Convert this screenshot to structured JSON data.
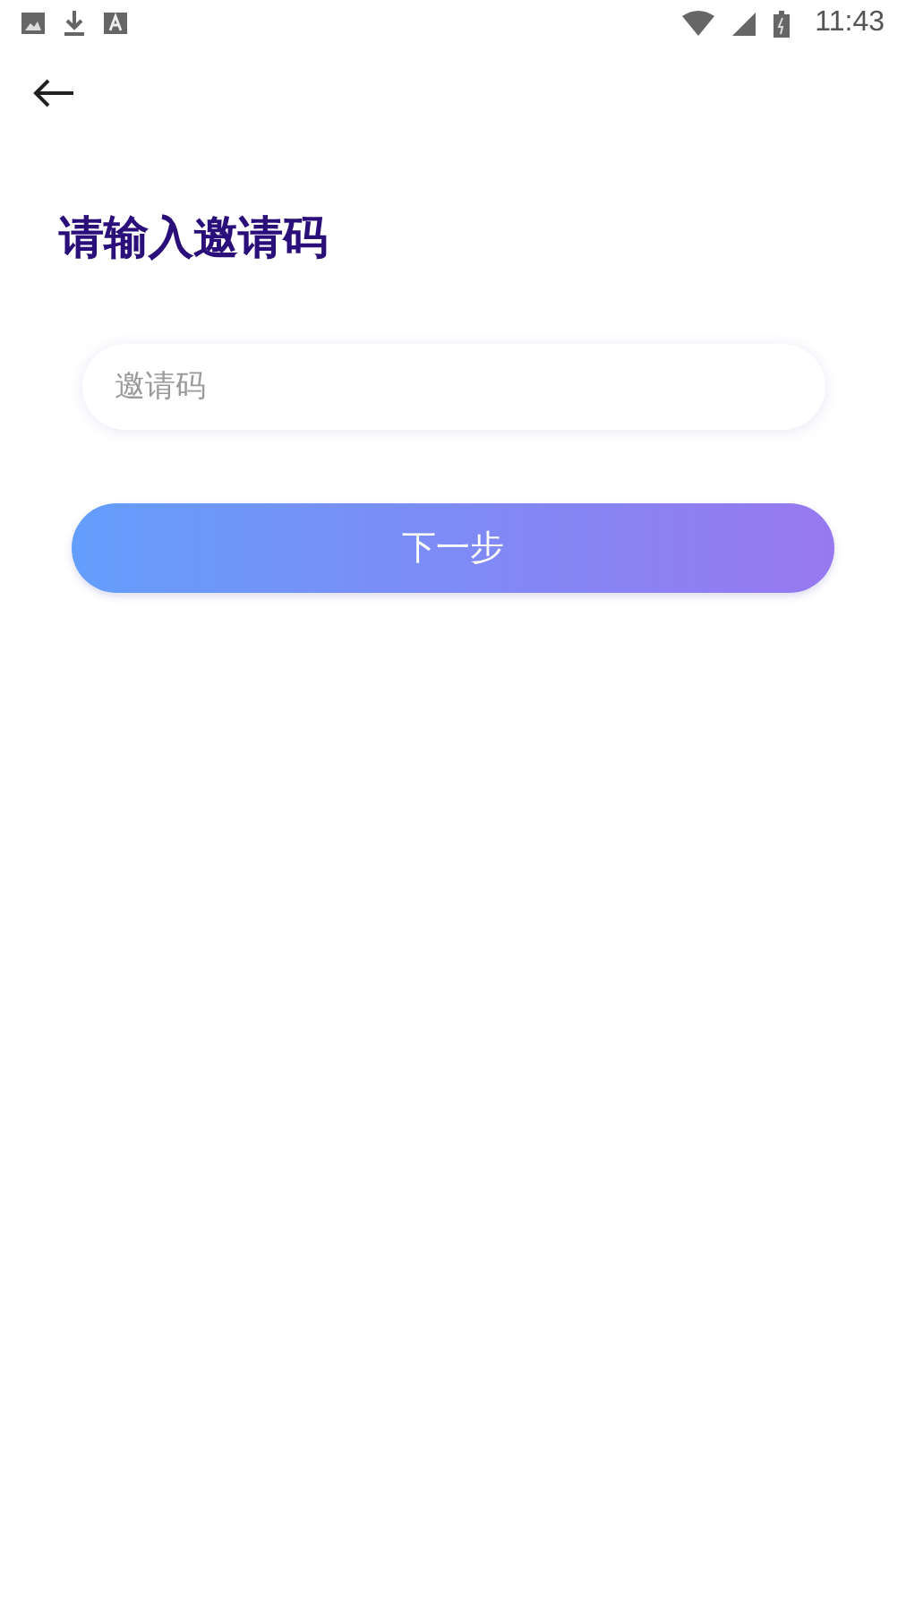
{
  "status_bar": {
    "time": "11:43"
  },
  "title": "请输入邀请码",
  "invite_field": {
    "placeholder": "邀请码"
  },
  "next_button": {
    "label": "下一步"
  }
}
